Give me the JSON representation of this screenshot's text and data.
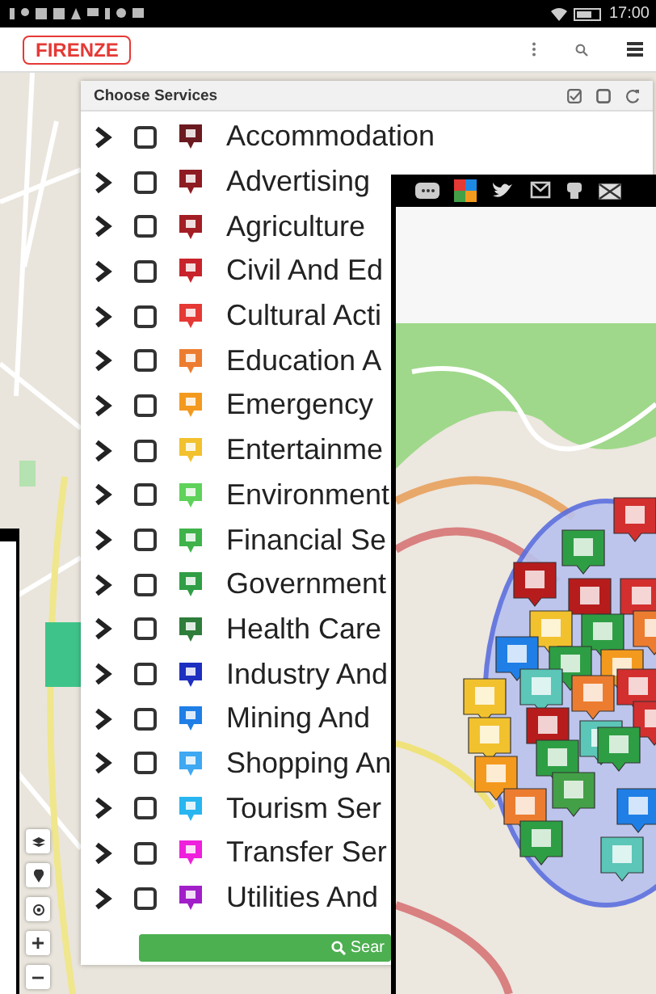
{
  "status_bar": {
    "time": "17:00"
  },
  "app_bar": {
    "title": "FIRENZE"
  },
  "services_panel": {
    "title": "Choose Services",
    "items": [
      {
        "label": "Accommodation",
        "expanded": false,
        "checked": false,
        "color": "#6b1a1f"
      },
      {
        "label": "Advertising",
        "expanded": false,
        "checked": false,
        "color": "#8e1b22"
      },
      {
        "label": "Agriculture",
        "expanded": false,
        "checked": false,
        "color": "#a31d24"
      },
      {
        "label": "Civil And Ed",
        "expanded": false,
        "checked": false,
        "color": "#c8232b"
      },
      {
        "label": "Cultural Acti",
        "expanded": false,
        "checked": false,
        "color": "#e53935"
      },
      {
        "label": "Education A",
        "expanded": false,
        "checked": false,
        "color": "#ec7d30"
      },
      {
        "label": "Emergency",
        "expanded": false,
        "checked": false,
        "color": "#f39a1e"
      },
      {
        "label": "Entertainme",
        "expanded": false,
        "checked": false,
        "color": "#f2c12e"
      },
      {
        "label": "Environment",
        "expanded": false,
        "checked": false,
        "color": "#5ed25a"
      },
      {
        "label": "Financial Se",
        "expanded": false,
        "checked": false,
        "color": "#3fb34a"
      },
      {
        "label": "Government",
        "expanded": false,
        "checked": false,
        "color": "#2f9e45"
      },
      {
        "label": "Health Care",
        "expanded": false,
        "checked": false,
        "color": "#2e7d3a"
      },
      {
        "label": "Industry And",
        "expanded": false,
        "checked": false,
        "color": "#1c2fc0"
      },
      {
        "label": "Mining And",
        "expanded": false,
        "checked": false,
        "color": "#1f7fe6"
      },
      {
        "label": "Shopping An",
        "expanded": false,
        "checked": false,
        "color": "#3ea8f2"
      },
      {
        "label": "Tourism Ser",
        "expanded": false,
        "checked": false,
        "color": "#28b5f0"
      },
      {
        "label": "Transfer Ser",
        "expanded": false,
        "checked": false,
        "color": "#ee20dc"
      },
      {
        "label": "Utilities And",
        "expanded": false,
        "checked": false,
        "color": "#a11fc8"
      }
    ],
    "search_button": "Sear"
  }
}
